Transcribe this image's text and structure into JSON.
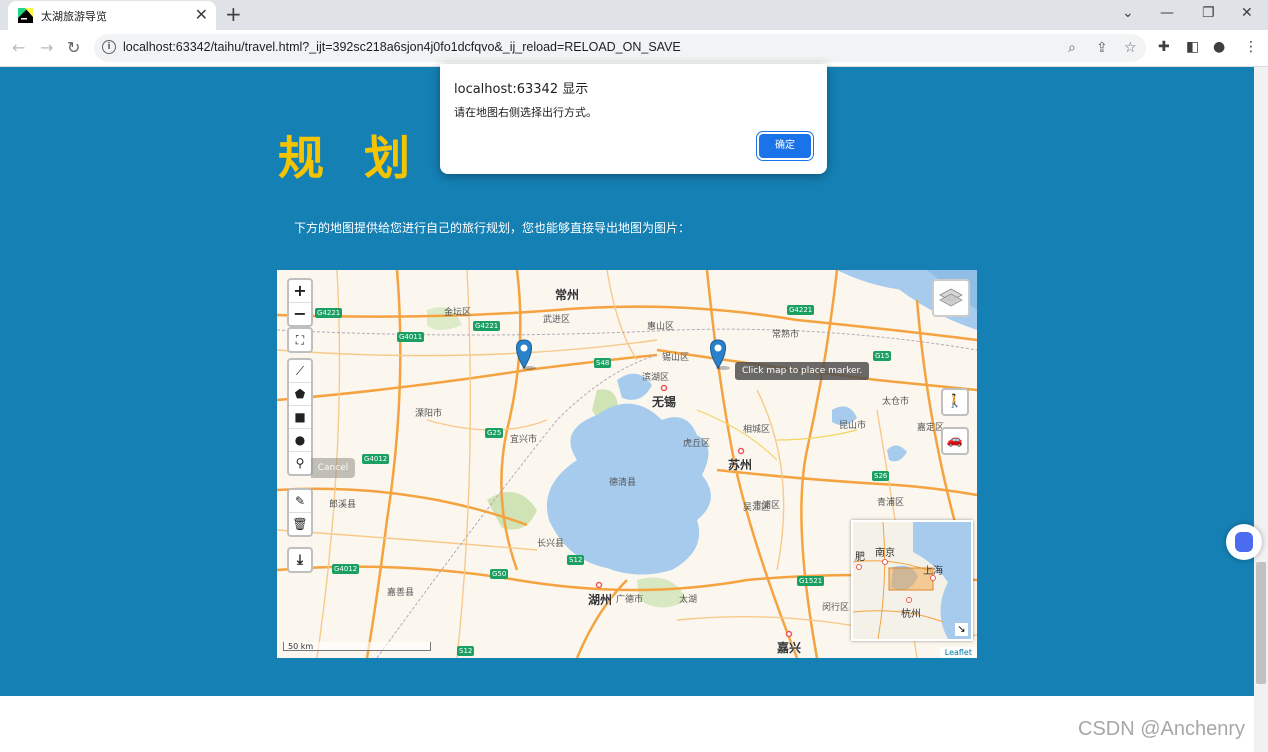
{
  "browser": {
    "tab_title": "太湖旅游导览",
    "tab_close": "✕",
    "new_tab": "+",
    "url": "localhost:63342/taihu/travel.html?_ijt=392sc218a6sjon4j0fo1dcfqvo&_ij_reload=RELOAD_ON_SAVE",
    "window_controls": {
      "chevron": "⌄",
      "minimize": "—",
      "restore": "❐",
      "close": "✕"
    },
    "nav": {
      "back": "←",
      "forward": "→",
      "reload": "↻"
    }
  },
  "page": {
    "heading": "规 划",
    "intro": "下方的地图提供给您进行自己的旅行规划，您也能够直接导出地图为图片："
  },
  "map": {
    "zoom_in": "+",
    "zoom_out": "−",
    "fullscreen": "⛶",
    "draw_tools": [
      "⟋",
      "⬟",
      "■",
      "●",
      "⚲"
    ],
    "edit_tools": [
      "✎",
      "🗑"
    ],
    "export": "⤓",
    "cancel": "Cancel",
    "tooltip": "Click map to place marker.",
    "scale": "50 km",
    "attribution": "Leaflet",
    "cities": [
      {
        "name": "常州"
      },
      {
        "name": "无锡"
      },
      {
        "name": "苏州"
      },
      {
        "name": "湖州"
      },
      {
        "name": "嘉兴"
      }
    ],
    "minimap_cities": [
      "南京",
      "上海",
      "杭州",
      "肥"
    ],
    "labels": [
      "金坛区",
      "武进区",
      "惠山区",
      "常熟市",
      "锡山区",
      "滨湖区",
      "溧阳市",
      "宜兴市",
      "虎丘区",
      "相城区",
      "吴中区",
      "昆山市",
      "太仓市",
      "嘉定区",
      "青浦区",
      "吴江区",
      "长兴县",
      "郎溪县",
      "安吉",
      "南浔区",
      "吴兴区",
      "德清县",
      "广德市",
      "太湖",
      "嘉善县",
      "闵行区",
      "崇明",
      "姑苏区"
    ],
    "shields": [
      "G4221",
      "G4011",
      "G4221",
      "S48",
      "G4221",
      "G15",
      "G25",
      "G4012",
      "S26",
      "G4012",
      "G50",
      "S12",
      "G1521",
      "S12"
    ]
  },
  "dialog": {
    "title": "localhost:63342 显示",
    "message": "请在地图右侧选择出行方式。",
    "ok": "确定"
  },
  "watermark": "CSDN @Anchenry",
  "colors": {
    "page_blue": "#1580b4",
    "heading_yellow": "#f5c400",
    "lake": "#a7cbed",
    "road": "#f4a340",
    "primary": "#1a73e8"
  }
}
